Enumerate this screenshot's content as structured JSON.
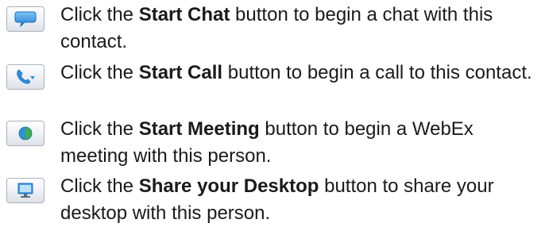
{
  "items": [
    {
      "icon": "chat-bubble-icon",
      "prefix": "Click the ",
      "bold": "Start Chat",
      "suffix": " button to begin a chat with this contact."
    },
    {
      "icon": "phone-handset-icon",
      "prefix": "Click the ",
      "bold": "Start Call",
      "suffix": " button to begin a call to this contact."
    },
    {
      "icon": "webex-meeting-icon",
      "prefix": "Click the ",
      "bold": "Start Meeting",
      "suffix": " button to begin a WebEx meeting with this person."
    },
    {
      "icon": "desktop-monitor-icon",
      "prefix": "Click the ",
      "bold": "Share your Desktop",
      "suffix": " button to share your desktop with this person."
    }
  ],
  "colors": {
    "icon_blue": "#2f8fdc",
    "icon_green": "#3cb14a",
    "button_border": "#aab2bc"
  }
}
